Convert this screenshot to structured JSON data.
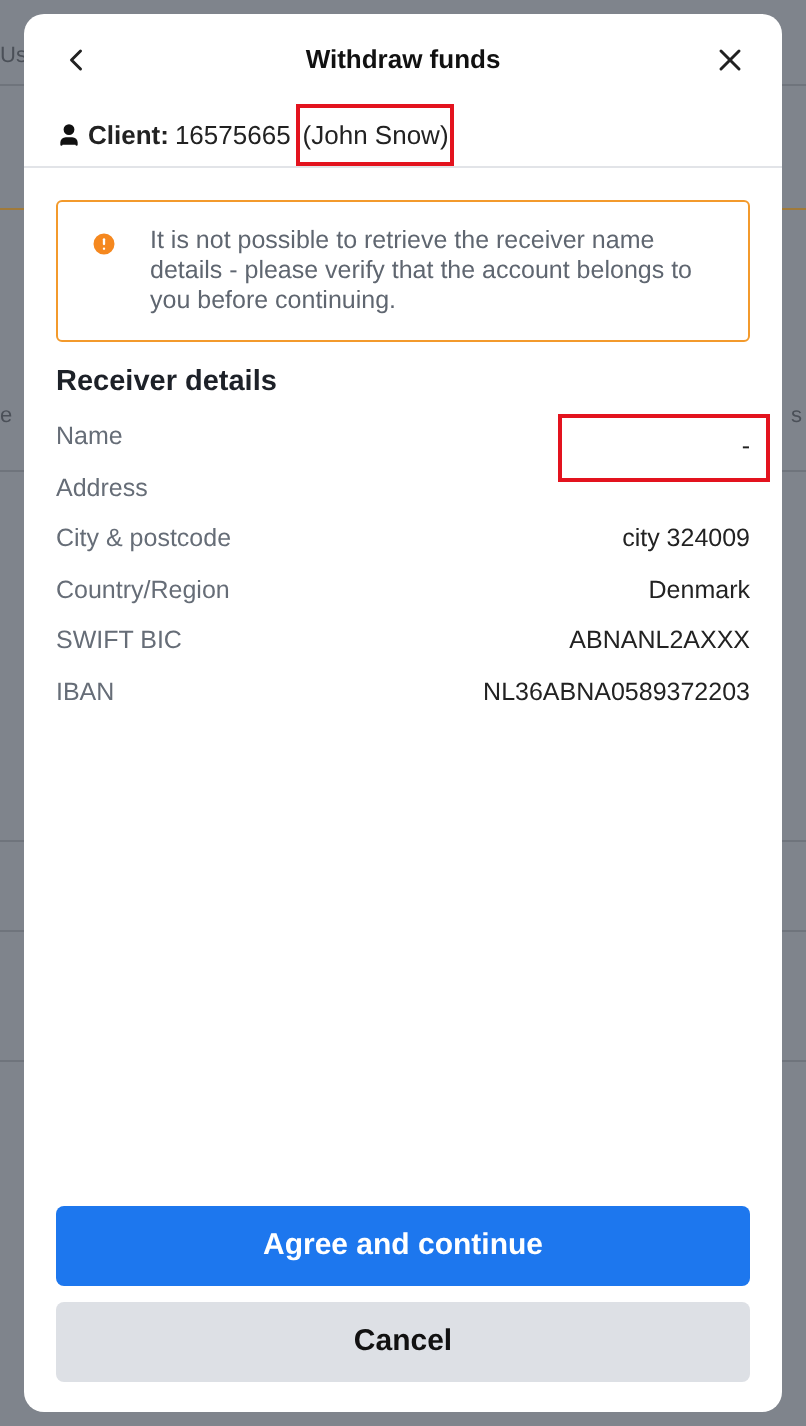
{
  "background": {
    "texts": [
      "Us",
      "e",
      "s"
    ]
  },
  "dialog": {
    "title": "Withdraw funds"
  },
  "client": {
    "label": "Client:",
    "id": "16575665",
    "name": "(John Snow)",
    "highlighted": true
  },
  "alert": {
    "text": "It is not possible to retrieve the receiver name details - please verify that the account belongs to you before continuing."
  },
  "receiver": {
    "heading": "Receiver details",
    "rows": [
      {
        "label": "Name",
        "value": "-",
        "highlighted": true
      },
      {
        "label": "Address",
        "highlighted": false
      },
      {
        "label": "City & postcode",
        "value": "city 324009",
        "highlighted": false
      },
      {
        "label": "Country/Region",
        "value": "Denmark",
        "highlighted": false
      },
      {
        "label": "SWIFT BIC",
        "value": "ABNANL2AXXX",
        "highlighted": false
      },
      {
        "label": "IBAN",
        "value": "NL36ABNA0589372203",
        "highlighted": false
      }
    ]
  },
  "buttons": [
    {
      "label": "Agree and continue",
      "kind": "primary"
    },
    {
      "label": "Cancel",
      "kind": "secondary"
    }
  ]
}
